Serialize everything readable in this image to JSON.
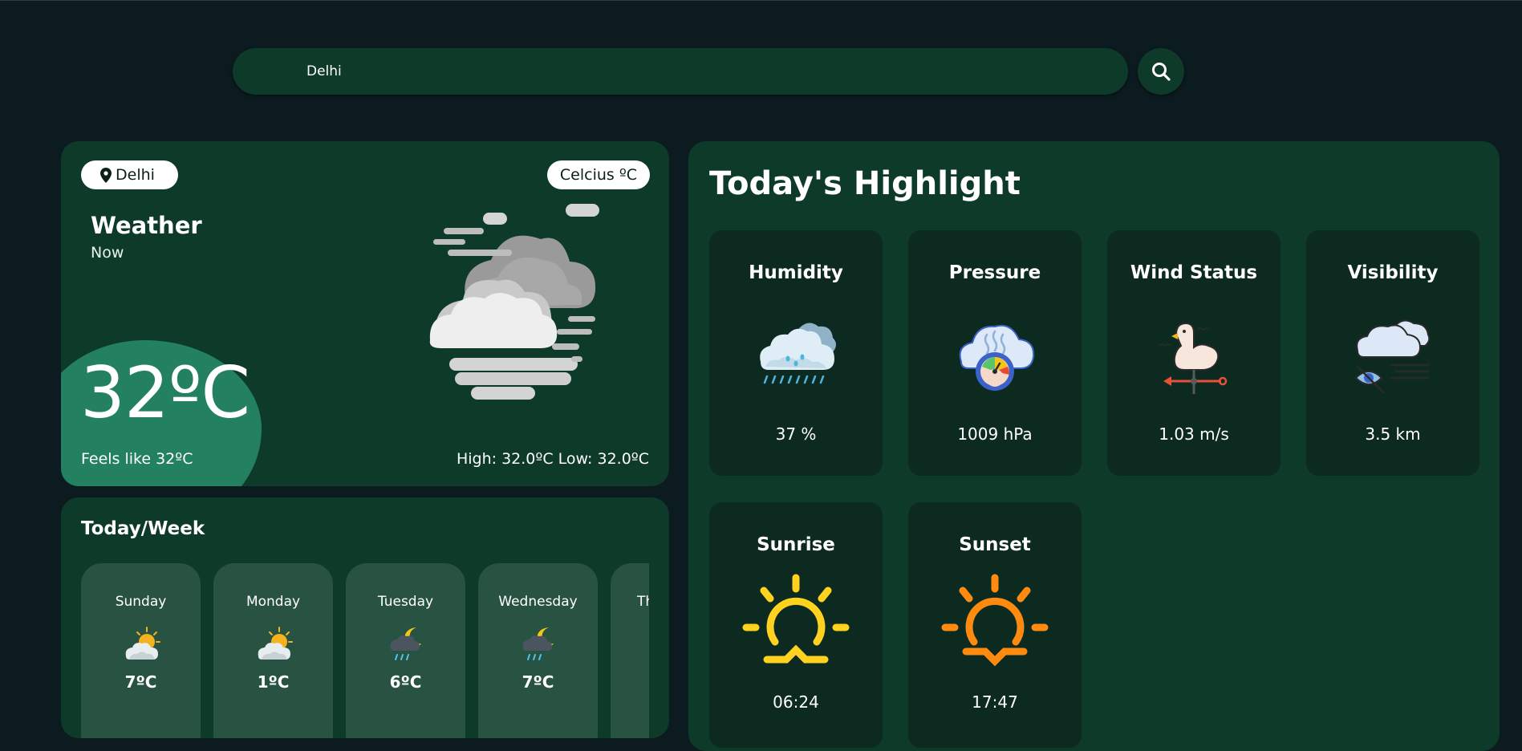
{
  "search": {
    "value": "Delhi"
  },
  "current": {
    "location": "Delhi",
    "unit": "Celcius ºC",
    "title": "Weather",
    "subtitle": "Now",
    "temperature": "32ºC",
    "feels_like": "Feels like 32ºC",
    "high_low": "High: 32.0ºC  Low: 32.0ºC",
    "icon": "haze-cloud-icon"
  },
  "week": {
    "title": "Today/Week",
    "days": [
      {
        "name": "Sunday",
        "temp": "7ºC",
        "icon": "partly-sunny-icon"
      },
      {
        "name": "Monday",
        "temp": "1ºC",
        "icon": "partly-sunny-icon"
      },
      {
        "name": "Tuesday",
        "temp": "6ºC",
        "icon": "night-rain-icon"
      },
      {
        "name": "Wednesday",
        "temp": "7ºC",
        "icon": "night-rain-icon"
      },
      {
        "name": "Th",
        "temp": "",
        "icon": ""
      }
    ]
  },
  "highlights": {
    "title": "Today's Highlight",
    "humidity": {
      "label": "Humidity",
      "value": "37 %",
      "icon": "rain-cloud-icon"
    },
    "pressure": {
      "label": "Pressure",
      "value": "1009 hPa",
      "icon": "pressure-gauge-icon"
    },
    "wind": {
      "label": "Wind Status",
      "value": "1.03 m/s",
      "icon": "weather-vane-icon"
    },
    "visibility": {
      "label": "Visibility",
      "value": "3.5 km",
      "icon": "visibility-cloud-icon"
    },
    "sunrise": {
      "label": "Sunrise",
      "value": "06:24",
      "icon": "sunrise-icon"
    },
    "sunset": {
      "label": "Sunset",
      "value": "17:47",
      "icon": "sunset-icon"
    }
  },
  "colors": {
    "background": "#0c1b20",
    "card": "#0d3a29",
    "tile": "#0c2a20",
    "accent_green": "#238060",
    "sunrise": "#ffd21f",
    "sunset": "#ff8a10"
  }
}
